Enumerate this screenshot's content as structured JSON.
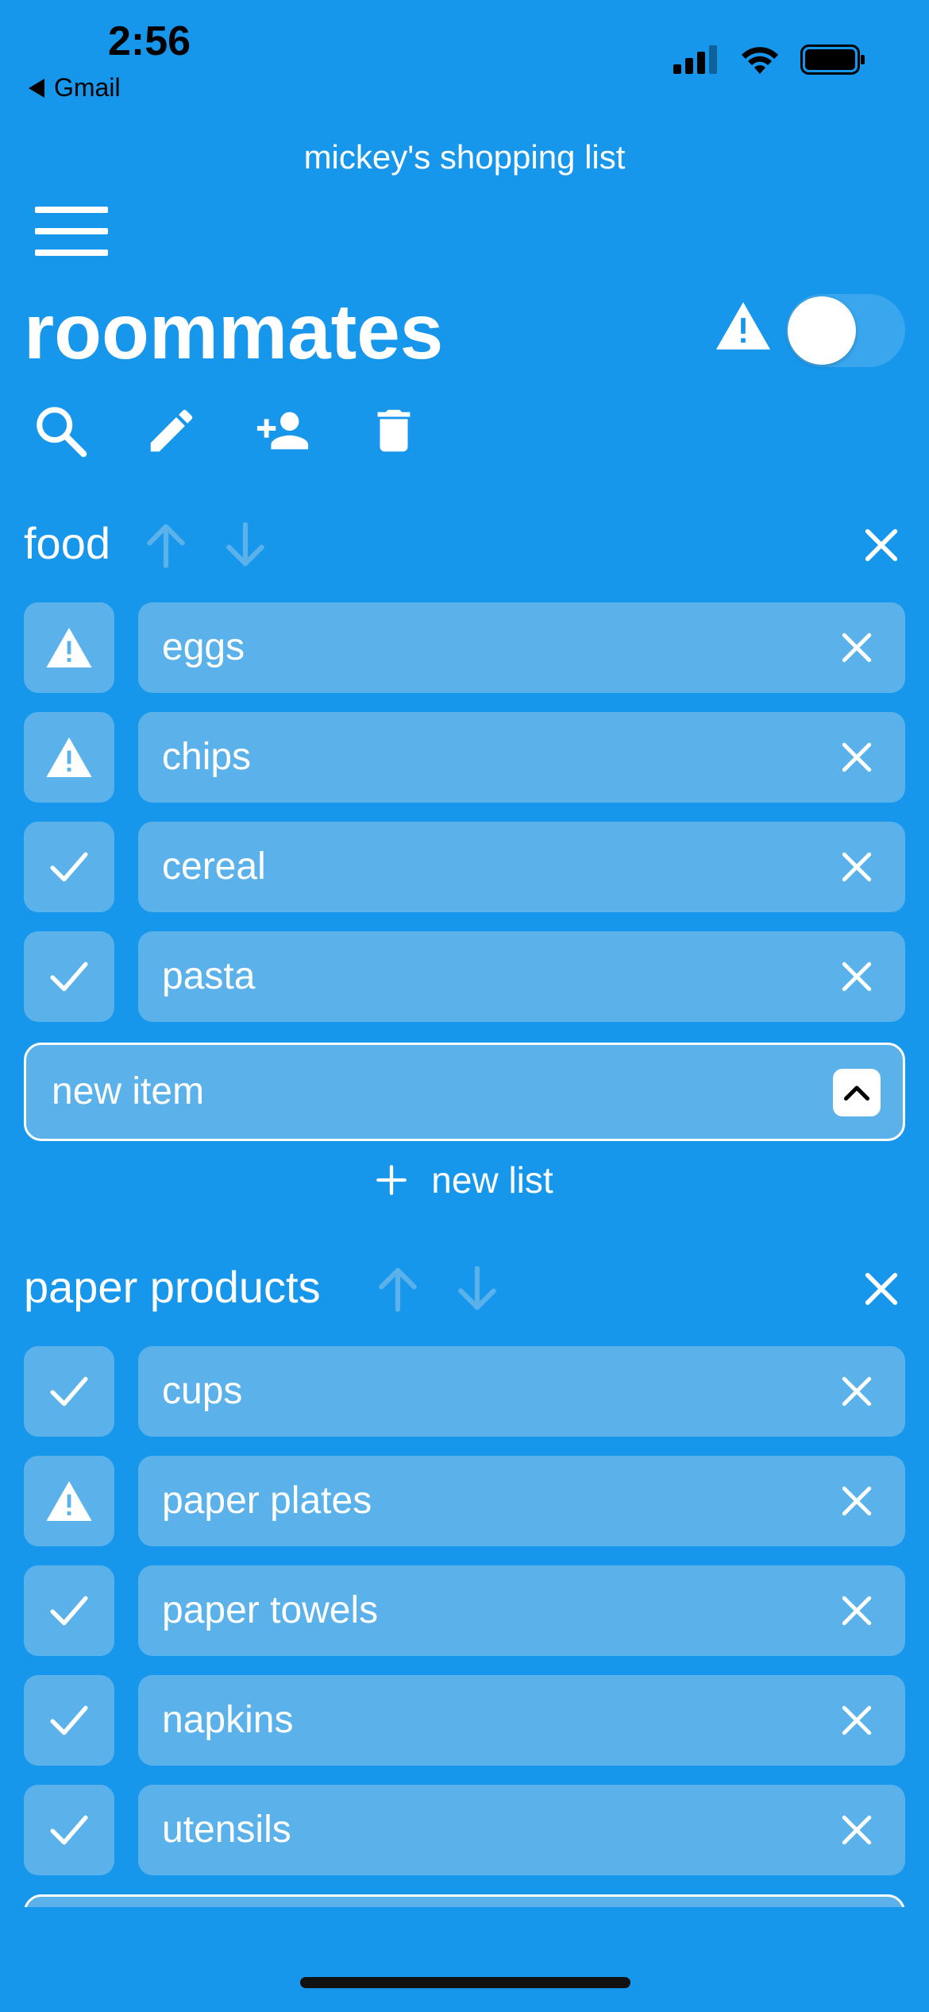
{
  "status_bar": {
    "time": "2:56",
    "back_app": "Gmail"
  },
  "app_title": "mickey's shopping list",
  "list_title": "roommates",
  "toolbar": {
    "icons": [
      "search-icon",
      "edit-icon",
      "add-person-icon",
      "trash-icon"
    ]
  },
  "toggle": {
    "on": false
  },
  "sections": [
    {
      "name": "food",
      "items": [
        {
          "label": "eggs",
          "status": "warning"
        },
        {
          "label": "chips",
          "status": "warning"
        },
        {
          "label": "cereal",
          "status": "checked"
        },
        {
          "label": "pasta",
          "status": "checked"
        }
      ],
      "new_item_placeholder": "new item"
    },
    {
      "name": "paper products",
      "items": [
        {
          "label": "cups",
          "status": "checked"
        },
        {
          "label": "paper plates",
          "status": "warning"
        },
        {
          "label": "paper towels",
          "status": "checked"
        },
        {
          "label": "napkins",
          "status": "checked"
        },
        {
          "label": "utensils",
          "status": "checked"
        }
      ]
    }
  ],
  "new_list_label": "new list",
  "colors": {
    "background": "#1797ec",
    "item_fill": "#5bb2ea",
    "text": "#ffffff"
  }
}
